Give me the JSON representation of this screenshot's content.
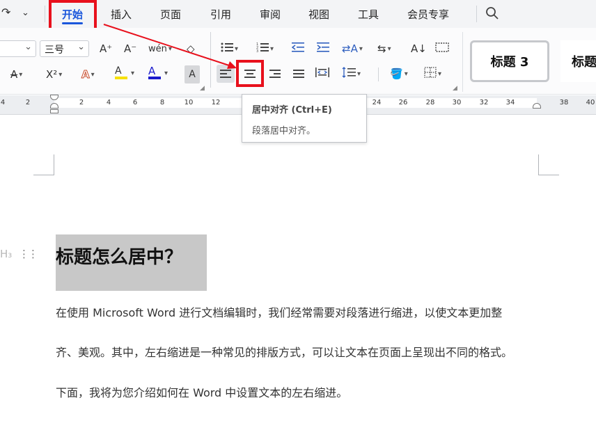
{
  "menubar": {
    "tabs": [
      "开始",
      "插入",
      "页面",
      "引用",
      "审阅",
      "视图",
      "工具",
      "会员专享"
    ],
    "active_tab": "开始",
    "search_icon": "search-icon"
  },
  "ribbon": {
    "font_size": "三号",
    "font_size_dropdown": "chevron-down-icon",
    "buttons_row1": [
      "A⁺",
      "A⁻",
      "wén",
      "◇"
    ],
    "buttons_row2": [
      "A",
      "X²",
      "A",
      "A",
      "A"
    ],
    "highlight_color": "#f7e000",
    "font_color": "#1a1acc",
    "accent_red": "#e8101c"
  },
  "styles": {
    "card1": "标题 3",
    "card2": "标题"
  },
  "ruler": {
    "left_ticks": [
      "4",
      "2"
    ],
    "ticks": [
      "2",
      "4",
      "6",
      "8",
      "10",
      "12",
      "24",
      "26",
      "28",
      "30",
      "32",
      "34",
      "38",
      "40"
    ]
  },
  "tooltip": {
    "title": "居中对齐 (Ctrl+E)",
    "description": "段落居中对齐。"
  },
  "document": {
    "heading_marker": "H₃",
    "heading": "标题怎么居中？",
    "paragraphs": [
      "在使用 Microsoft Word 进行文档编辑时，我们经常需要对段落进行缩进，以使文本更加整",
      "齐、美观。其中，左右缩进是一种常见的排版方式，可以让文本在页面上呈现出不同的格式。",
      "下面，我将为您介绍如何在 Word 中设置文本的左右缩进。"
    ]
  }
}
